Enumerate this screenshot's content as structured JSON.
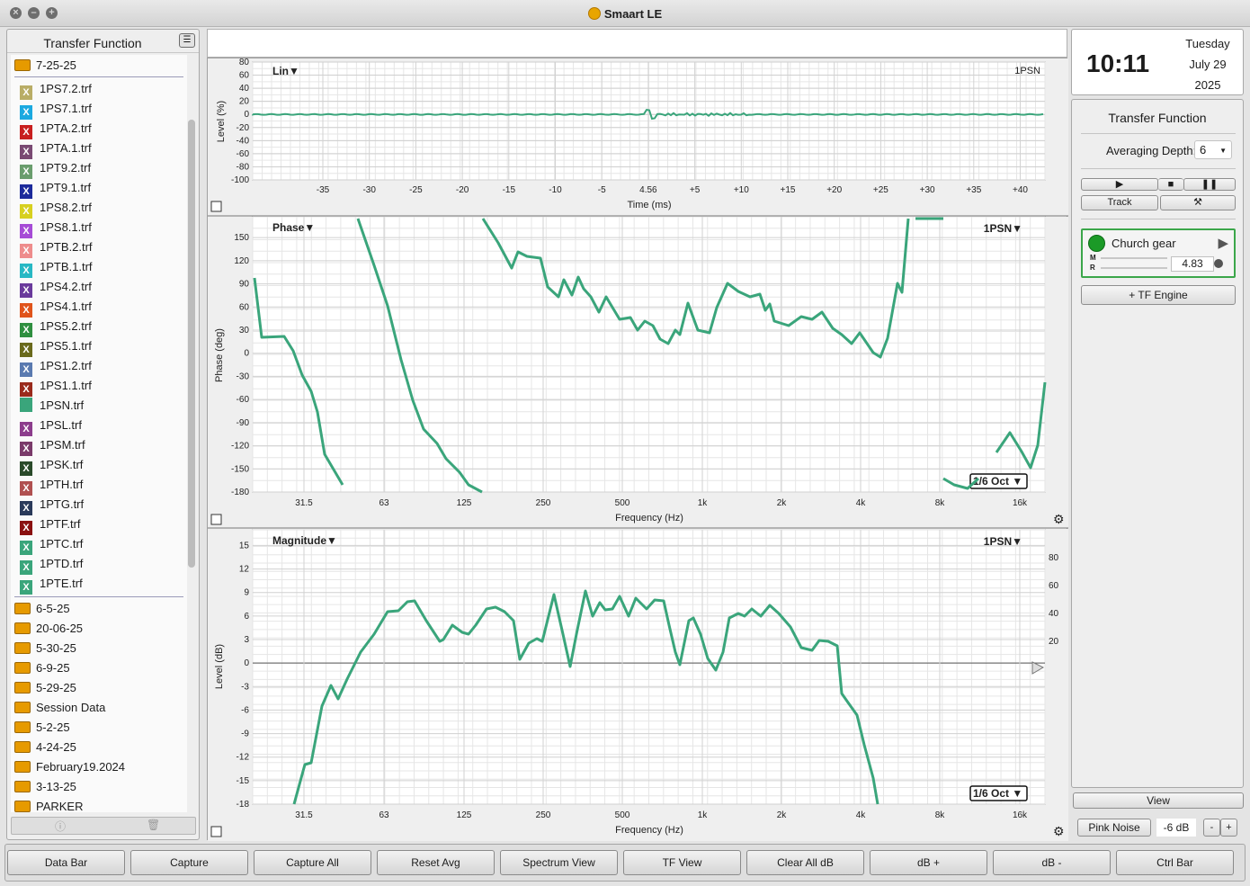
{
  "window": {
    "title": "Smaart LE"
  },
  "sidebar": {
    "title": "Transfer Function",
    "open_folder": "7-25-25",
    "files": [
      {
        "name": "1PS7.2.trf",
        "color": "#b9ad66"
      },
      {
        "name": "1PS7.1.trf",
        "color": "#1ba9e0"
      },
      {
        "name": "1PTA.2.trf",
        "color": "#c81f1f"
      },
      {
        "name": "1PTA.1.trf",
        "color": "#7a4a73"
      },
      {
        "name": "1PT9.2.trf",
        "color": "#6a9d6d"
      },
      {
        "name": "1PT9.1.trf",
        "color": "#1c2a9b"
      },
      {
        "name": "1PS8.2.trf",
        "color": "#d7d01f"
      },
      {
        "name": "1PS8.1.trf",
        "color": "#a64bd6"
      },
      {
        "name": "1PTB.2.trf",
        "color": "#ee8c8c"
      },
      {
        "name": "1PTB.1.trf",
        "color": "#28b8c4"
      },
      {
        "name": "1PS4.2.trf",
        "color": "#6a3a9c"
      },
      {
        "name": "1PS4.1.trf",
        "color": "#e0541b"
      },
      {
        "name": "1PS5.2.trf",
        "color": "#2f8f40"
      },
      {
        "name": "1PS5.1.trf",
        "color": "#6a6a1c"
      },
      {
        "name": "1PS1.2.trf",
        "color": "#5a7ab0"
      },
      {
        "name": "1PS1.1.trf",
        "color": "#9a2a1c"
      },
      {
        "name": "1PSN.trf",
        "color": "#3aa57b"
      },
      {
        "name": "1PSL.trf",
        "color": "#8c3d8c"
      },
      {
        "name": "1PSM.trf",
        "color": "#7a3a6a"
      },
      {
        "name": "1PSK.trf",
        "color": "#2a4a2a"
      },
      {
        "name": "1PTH.trf",
        "color": "#b05050"
      },
      {
        "name": "1PTG.trf",
        "color": "#2a3a5a"
      },
      {
        "name": "1PTF.trf",
        "color": "#8a1010"
      },
      {
        "name": "1PTC.trf",
        "color": "#3aa57b"
      },
      {
        "name": "1PTD.trf",
        "color": "#3aa57b"
      },
      {
        "name": "1PTE.trf",
        "color": "#3aa57b"
      }
    ],
    "folders": [
      "6-5-25",
      "20-06-25",
      "5-30-25",
      "6-9-25",
      "5-29-25",
      "Session Data",
      "5-2-25",
      "4-24-25",
      "February19.2024",
      "3-13-25",
      "PARKER"
    ]
  },
  "graphs": {
    "impulse": {
      "mode_label": "Lin",
      "trace_label": "1PSN",
      "ylabel": "Level (%)",
      "xlabel": "Time (ms)",
      "yticks": [
        "80",
        "60",
        "40",
        "20",
        "0",
        "-20",
        "-40",
        "-60",
        "-80",
        "-100"
      ],
      "xticks": [
        "-35",
        "-30",
        "-25",
        "-20",
        "-15",
        "-10",
        "-5",
        "4.56",
        "+5",
        "+10",
        "+15",
        "+20",
        "+25",
        "+30",
        "+35",
        "+40"
      ]
    },
    "phase": {
      "mode_label": "Phase",
      "trace_label": "1PSN",
      "ylabel": "Phase (deg)",
      "xlabel": "Frequency (Hz)",
      "smoothing": "1/6 Oct",
      "yticks": [
        "150",
        "120",
        "90",
        "60",
        "30",
        "0",
        "-30",
        "-60",
        "-90",
        "-120",
        "-150",
        "-180"
      ],
      "xticks": [
        "31.5",
        "63",
        "125",
        "250",
        "500",
        "1k",
        "2k",
        "4k",
        "8k",
        "16k"
      ]
    },
    "magnitude": {
      "mode_label": "Magnitude",
      "trace_label": "1PSN",
      "ylabel": "Level (dB)",
      "xlabel": "Frequency (Hz)",
      "smoothing": "1/6 Oct",
      "yticks": [
        "15",
        "12",
        "9",
        "6",
        "3",
        "0",
        "-3",
        "-6",
        "-9",
        "-12",
        "-15",
        "-18"
      ],
      "right_ticks": [
        "80",
        "60",
        "40",
        "20"
      ],
      "xticks": [
        "31.5",
        "63",
        "125",
        "250",
        "500",
        "1k",
        "2k",
        "4k",
        "8k",
        "16k"
      ]
    },
    "trace_color": "#3aa57b"
  },
  "clock": {
    "time": "10:11",
    "day": "Tuesday",
    "date": "July 29",
    "year": "2025"
  },
  "tf_panel": {
    "title": "Transfer Function",
    "averaging_label": "Averaging Depth:",
    "averaging_value": "6",
    "track_label": "Track",
    "engine_name": "Church gear",
    "engine_value": "4.83",
    "engine_m": "M",
    "engine_r": "R",
    "add_engine": "+ TF Engine"
  },
  "view_label": "View",
  "generator": {
    "pink_label": "Pink Noise",
    "level": "-6 dB",
    "minus": "-",
    "plus": "+"
  },
  "command_bar": [
    "Data Bar",
    "Capture",
    "Capture All",
    "Reset Avg",
    "Spectrum View",
    "TF View",
    "Clear All dB",
    "dB +",
    "dB -",
    "Ctrl Bar"
  ]
}
